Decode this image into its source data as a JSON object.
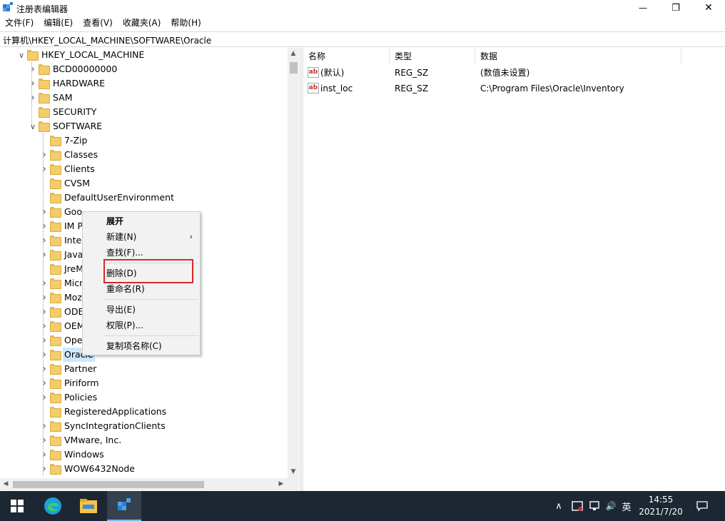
{
  "window": {
    "title": "注册表编辑器",
    "minimize_glyph": "—",
    "restore_glyph": "❐",
    "close_glyph": "✕"
  },
  "menu": [
    "文件(F)",
    "编辑(E)",
    "查看(V)",
    "收藏夹(A)",
    "帮助(H)"
  ],
  "address": "计算机\\HKEY_LOCAL_MACHINE\\SOFTWARE\\Oracle",
  "tree": {
    "root": "HKEY_LOCAL_MACHINE",
    "hklm_children": [
      "BCD00000000",
      "HARDWARE",
      "SAM",
      "SECURITY",
      "SOFTWARE"
    ],
    "software_children": [
      "7-Zip",
      "Classes",
      "Clients",
      "CVSM",
      "DefaultUserEnvironment",
      "Goo",
      "IM P",
      "Intel",
      "Java",
      "JreM",
      "Micr",
      "Moz",
      "ODE",
      "OEM",
      "Ope",
      "Oracle",
      "Partner",
      "Piriform",
      "Policies",
      "RegisteredApplications",
      "SyncIntegrationClients",
      "VMware, Inc.",
      "Windows",
      "WOW6432Node"
    ],
    "selected": "Oracle"
  },
  "values": {
    "columns": [
      "名称",
      "类型",
      "数据"
    ],
    "rows": [
      {
        "name": "(默认)",
        "type": "REG_SZ",
        "data": "(数值未设置)"
      },
      {
        "name": "inst_loc",
        "type": "REG_SZ",
        "data": "C:\\Program Files\\Oracle\\Inventory"
      }
    ],
    "icon": "ab"
  },
  "context_menu": {
    "items": [
      "展开",
      "新建(N)",
      "查找(F)...",
      "删除(D)",
      "重命名(R)",
      "导出(E)",
      "权限(P)...",
      "复制项名称(C)"
    ],
    "submenu_arrow": "›",
    "highlighted": "删除(D)"
  },
  "taskbar": {
    "time": "14:55",
    "date": "2021/7/20",
    "ime": "英",
    "tray_up": "∧",
    "volume_glyph": "🔊"
  },
  "colors": {
    "selection": "#cce8ff",
    "highlight_box": "#d9262b",
    "taskbar": "#1c2733",
    "folder": "#f3cd6a"
  }
}
